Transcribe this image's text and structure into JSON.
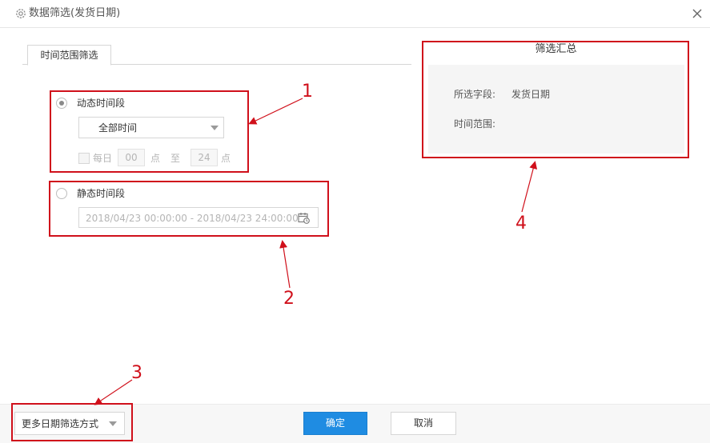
{
  "dialog": {
    "title": "数据筛选(发货日期)",
    "icon": "gear-icon",
    "close_icon": "close-icon"
  },
  "tabs": [
    {
      "label": "时间范围筛选",
      "active": true
    }
  ],
  "dynamic": {
    "label": "动态时间段",
    "selected": true,
    "range_select": "全部时间",
    "daily": {
      "checkbox_label": "每日",
      "checked": false,
      "start_hour": "00",
      "unit1": "点",
      "separator": "至",
      "end_hour": "24",
      "unit2": "点"
    }
  },
  "static": {
    "label": "静态时间段",
    "selected": false,
    "date_range_value": "2018/04/23 00:00:00 - 2018/04/23 24:00:00",
    "icon": "calendar-clock-icon"
  },
  "summary": {
    "title": "筛选汇总",
    "field_label": "所选字段:",
    "field_value": "发货日期",
    "range_label": "时间范围:",
    "range_value": ""
  },
  "footer": {
    "more_methods": "更多日期筛选方式",
    "confirm": "确定",
    "cancel": "取消"
  },
  "annotations": [
    "1",
    "2",
    "3",
    "4"
  ],
  "colors": {
    "annotation_red": "#d0101b",
    "primary_blue": "#1f8ce2",
    "summary_bg": "#f5f5f5"
  }
}
